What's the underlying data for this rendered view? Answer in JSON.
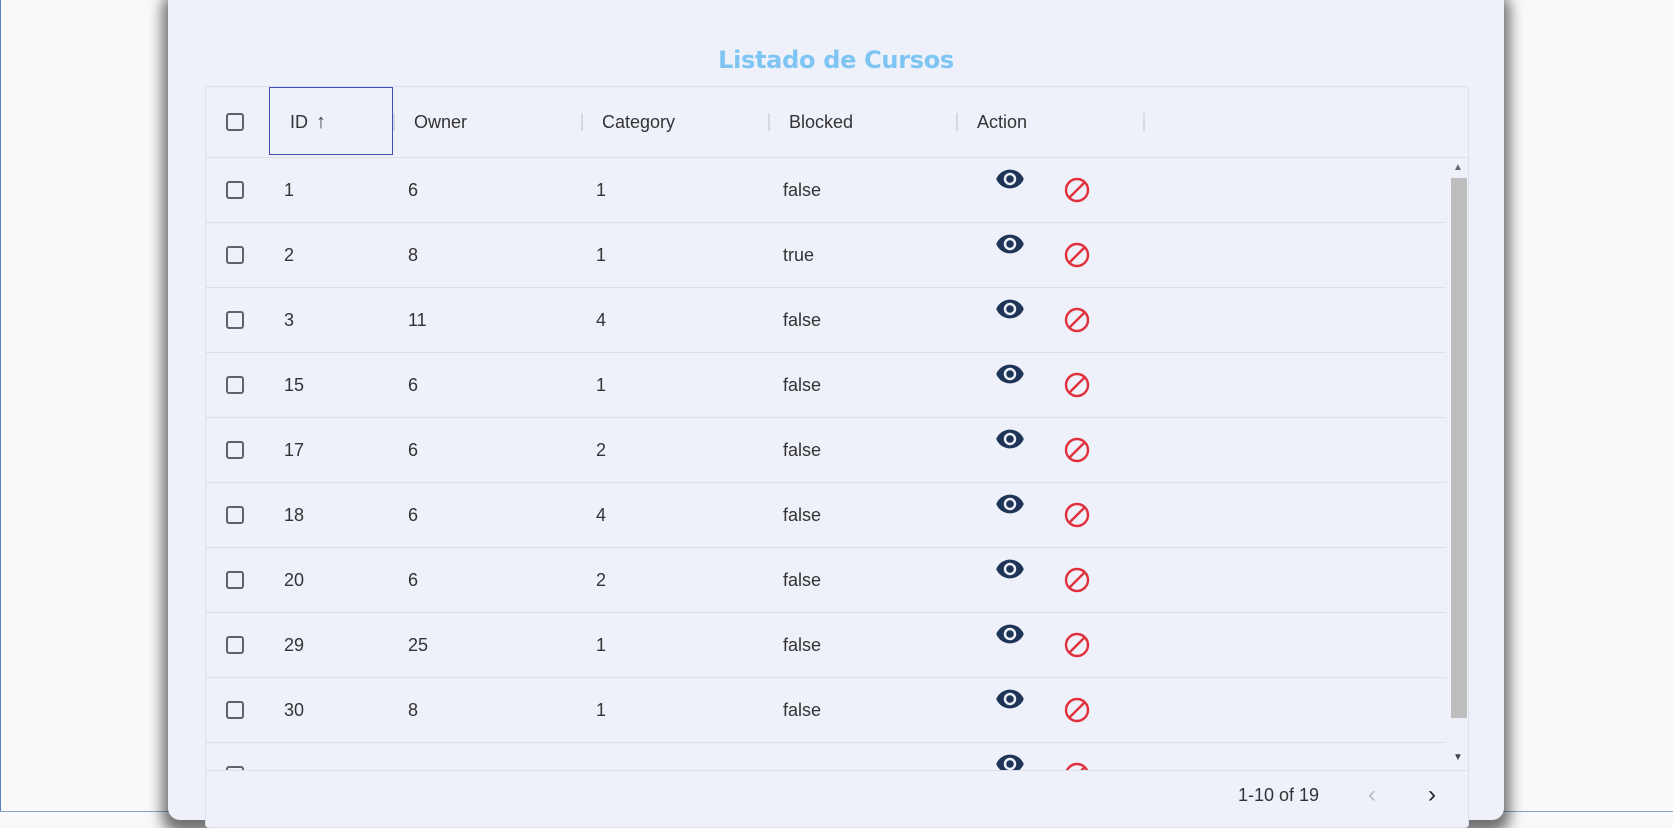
{
  "title": "Listado de Cursos",
  "columns": {
    "id": "ID",
    "owner": "Owner",
    "category": "Category",
    "blocked": "Blocked",
    "action": "Action"
  },
  "rows": [
    {
      "id": "1",
      "owner": "6",
      "category": "1",
      "blocked": "false"
    },
    {
      "id": "2",
      "owner": "8",
      "category": "1",
      "blocked": "true"
    },
    {
      "id": "3",
      "owner": "11",
      "category": "4",
      "blocked": "false"
    },
    {
      "id": "15",
      "owner": "6",
      "category": "1",
      "blocked": "false"
    },
    {
      "id": "17",
      "owner": "6",
      "category": "2",
      "blocked": "false"
    },
    {
      "id": "18",
      "owner": "6",
      "category": "4",
      "blocked": "false"
    },
    {
      "id": "20",
      "owner": "6",
      "category": "2",
      "blocked": "false"
    },
    {
      "id": "29",
      "owner": "25",
      "category": "1",
      "blocked": "false"
    },
    {
      "id": "30",
      "owner": "8",
      "category": "1",
      "blocked": "false"
    },
    {
      "id": "",
      "owner": "",
      "category": "",
      "blocked": ""
    }
  ],
  "pagination": {
    "label": "1-10 of 19"
  },
  "icons": {
    "view": "eye-icon",
    "block": "block-icon",
    "sort": "arrow-up-icon"
  },
  "colors": {
    "title": "#7ec5f4",
    "eye": "#1e3557",
    "block": "#e0303c",
    "focus": "#3f51b5"
  }
}
